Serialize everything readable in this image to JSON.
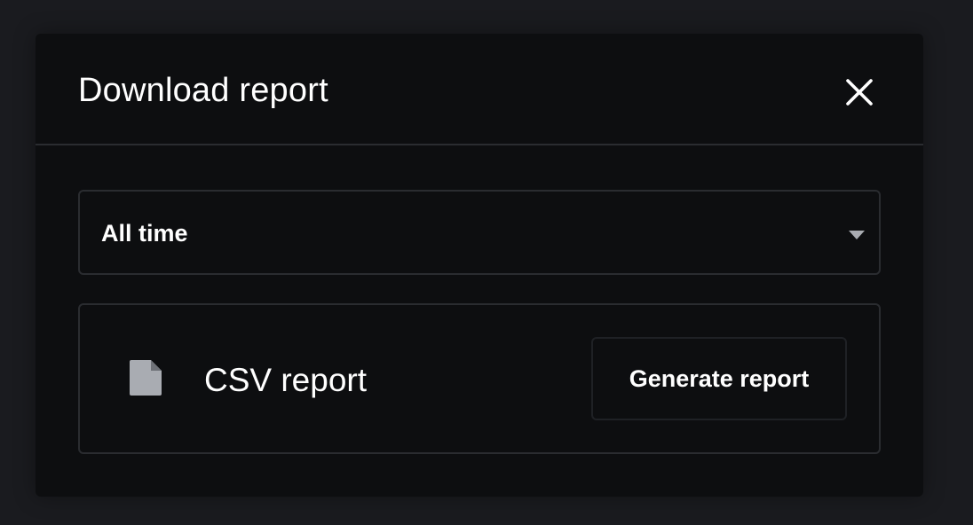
{
  "dialog": {
    "title": "Download report",
    "close_icon": "close-icon"
  },
  "period_select": {
    "selected": "All time",
    "arrow_icon": "caret-down-icon"
  },
  "report": {
    "icon": "file-icon",
    "label": "CSV report",
    "action_label": "Generate report"
  },
  "colors": {
    "page_background": "#1a1b1f",
    "dialog_background": "#0d0e10",
    "border": "#2a2c30",
    "text": "#ffffff",
    "icon_muted": "#a9acb2"
  }
}
